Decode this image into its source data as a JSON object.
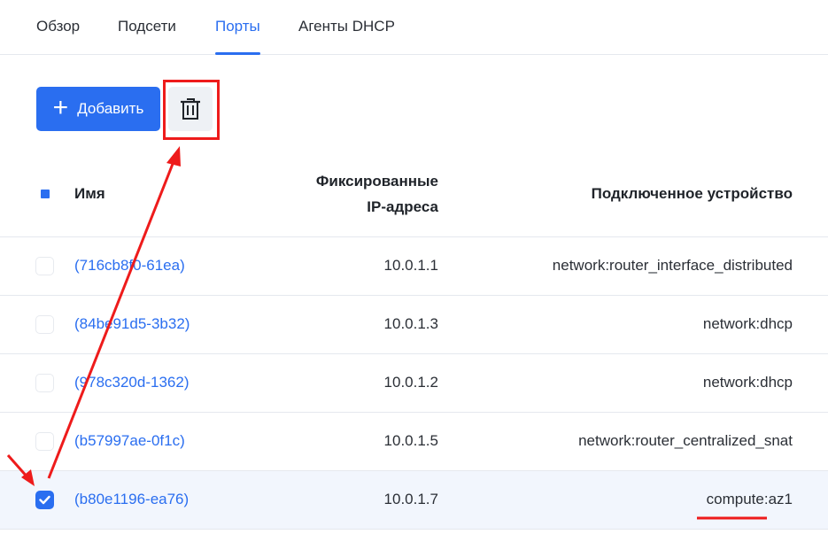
{
  "tabs": [
    {
      "label": "Обзор"
    },
    {
      "label": "Подсети"
    },
    {
      "label": "Порты"
    },
    {
      "label": "Агенты DHCP"
    }
  ],
  "active_tab": "Порты",
  "toolbar": {
    "add_label": "Добавить"
  },
  "table": {
    "columns": {
      "name": "Имя",
      "fixed_ip_line1": "Фиксированные",
      "fixed_ip_line2": "IP-адреса",
      "device": "Подключенное устройство"
    },
    "rows": [
      {
        "name": "(716cb8f0-61ea)",
        "ip": "10.0.1.1",
        "device": "network:router_interface_distributed",
        "checked": false
      },
      {
        "name": "(84be91d5-3b32)",
        "ip": "10.0.1.3",
        "device": "network:dhcp",
        "checked": false
      },
      {
        "name": "(978c320d-1362)",
        "ip": "10.0.1.2",
        "device": "network:dhcp",
        "checked": false
      },
      {
        "name": "(b57997ae-0f1c)",
        "ip": "10.0.1.5",
        "device": "network:router_centralized_snat",
        "checked": false
      },
      {
        "name": "(b80e1196-ea76)",
        "ip": "10.0.1.7",
        "device": "compute:az1",
        "checked": true
      }
    ]
  },
  "colors": {
    "accent": "#2a6ef0",
    "annotation": "#ee1b1b",
    "selected_row": "#f2f6fd"
  }
}
